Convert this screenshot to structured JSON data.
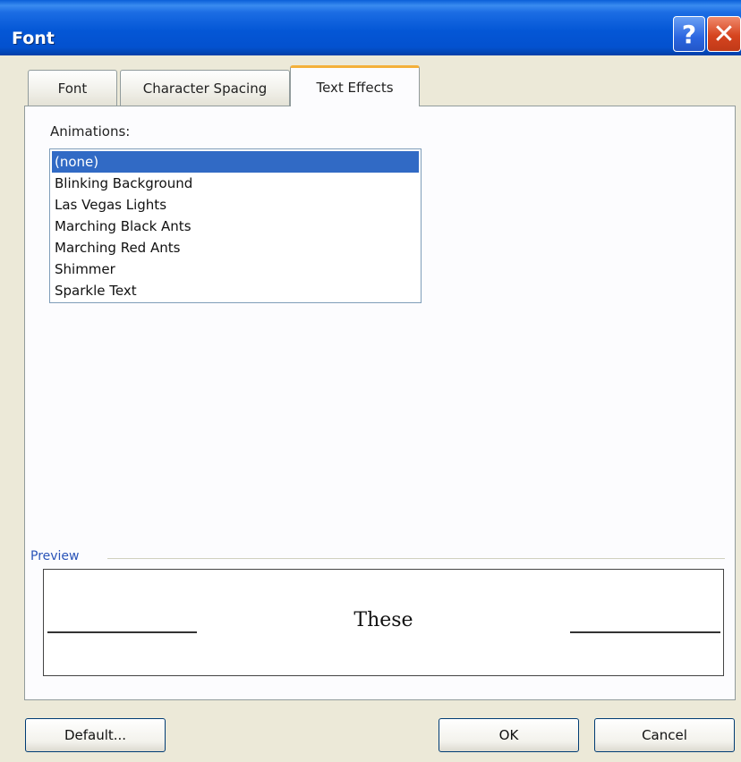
{
  "window": {
    "title": "Font"
  },
  "title_buttons": {
    "help": "?",
    "close": "✕"
  },
  "tabs": [
    {
      "label": "Font"
    },
    {
      "label": "Character Spacing"
    },
    {
      "label": "Text Effects"
    }
  ],
  "animations": {
    "label": "Animations:",
    "items": [
      "(none)",
      "Blinking Background",
      "Las Vegas Lights",
      "Marching Black Ants",
      "Marching Red Ants",
      "Shimmer",
      "Sparkle Text"
    ],
    "selected": "(none)"
  },
  "preview": {
    "label": "Preview",
    "text": "These"
  },
  "buttons": {
    "default": "Default...",
    "ok": "OK",
    "cancel": "Cancel"
  },
  "colors": {
    "titlebar": "#0457d6",
    "selection": "#316ac5",
    "active_tab_accent": "#f4b03a",
    "preview_label": "#2a54b8"
  }
}
